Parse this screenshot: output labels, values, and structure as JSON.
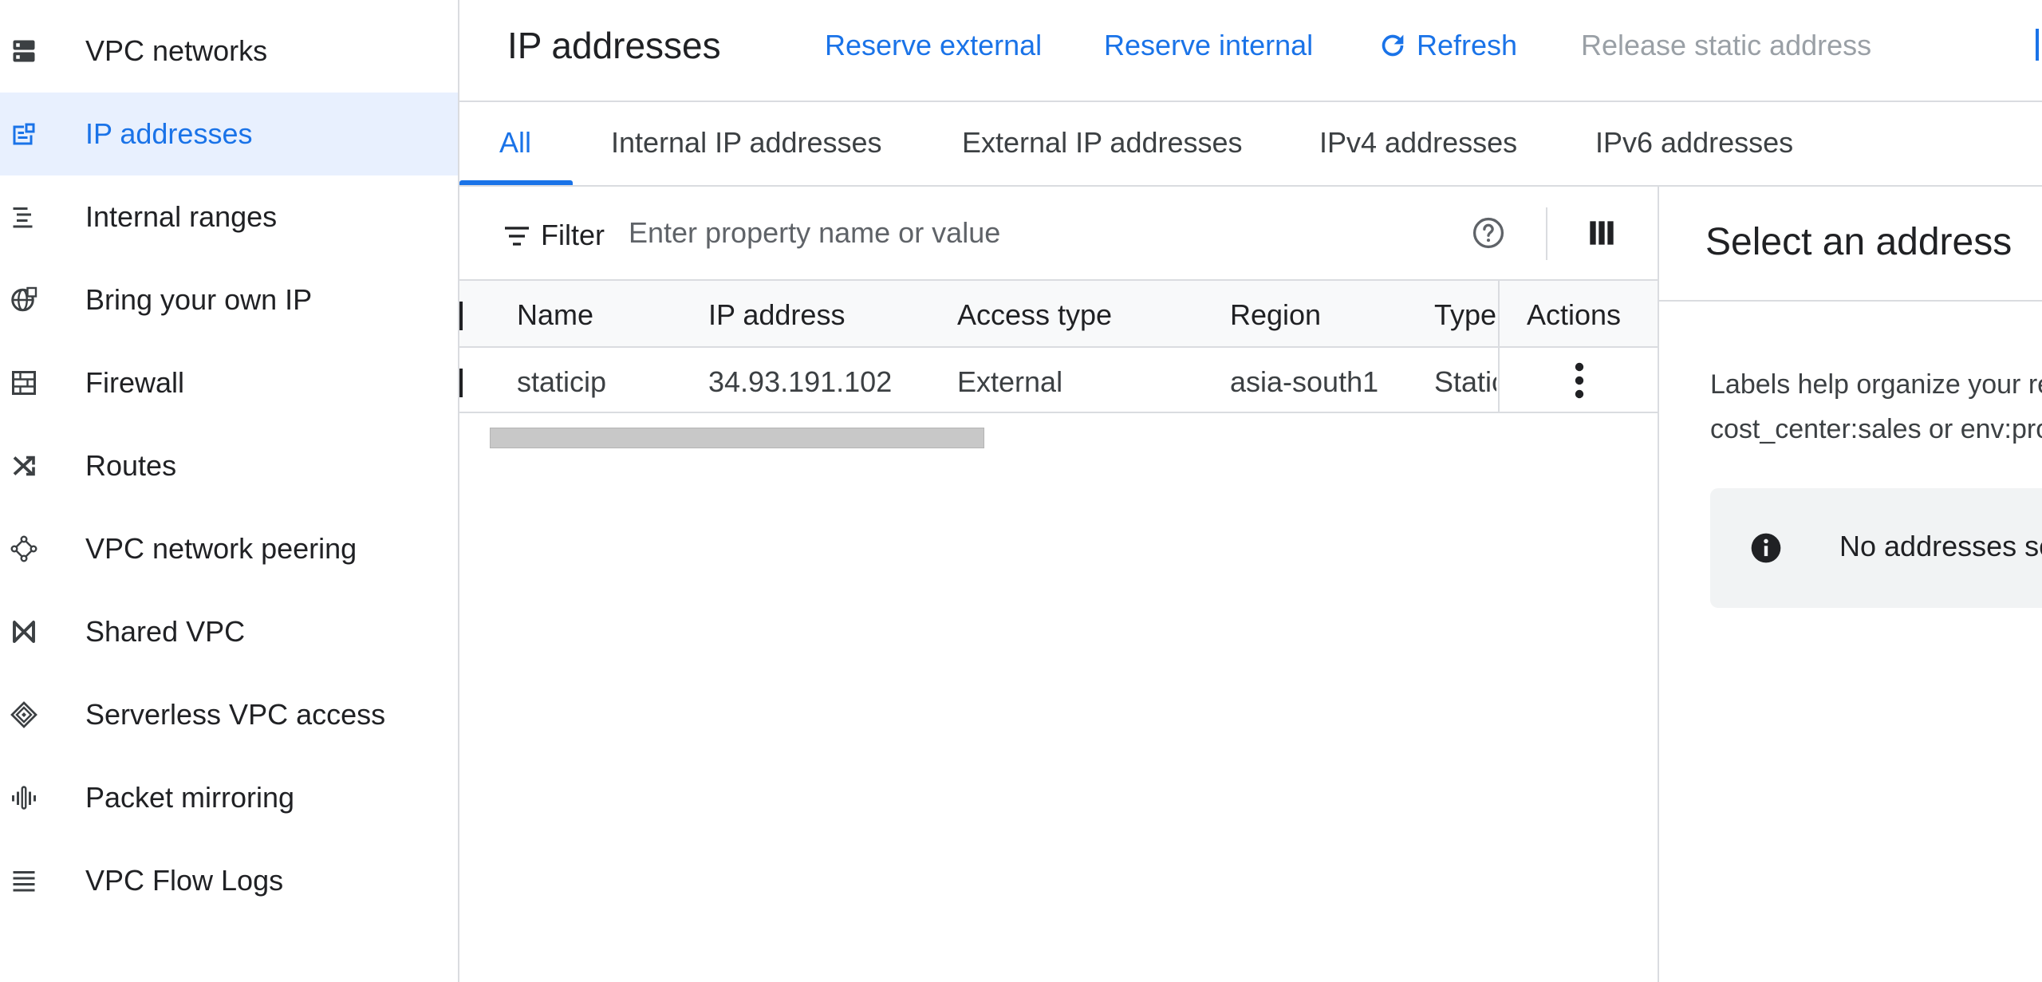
{
  "sidebar": {
    "items": [
      {
        "label": "VPC networks",
        "icon": "vpc-networks-icon"
      },
      {
        "label": "IP addresses",
        "icon": "ip-addresses-icon",
        "active": true
      },
      {
        "label": "Internal ranges",
        "icon": "internal-ranges-icon"
      },
      {
        "label": "Bring your own IP",
        "icon": "globe-icon"
      },
      {
        "label": "Firewall",
        "icon": "firewall-icon"
      },
      {
        "label": "Routes",
        "icon": "routes-icon"
      },
      {
        "label": "VPC network peering",
        "icon": "peering-icon"
      },
      {
        "label": "Shared VPC",
        "icon": "shared-vpc-icon"
      },
      {
        "label": "Serverless VPC access",
        "icon": "serverless-icon"
      },
      {
        "label": "Packet mirroring",
        "icon": "packet-mirroring-icon"
      },
      {
        "label": "VPC Flow Logs",
        "icon": "flow-logs-icon"
      }
    ]
  },
  "header": {
    "title": "IP addresses",
    "reserve_external": "Reserve external",
    "reserve_internal": "Reserve internal",
    "refresh": "Refresh",
    "release": "Release static address"
  },
  "tabs": [
    {
      "label": "All",
      "active": true
    },
    {
      "label": "Internal IP addresses"
    },
    {
      "label": "External IP addresses"
    },
    {
      "label": "IPv4 addresses"
    },
    {
      "label": "IPv6 addresses"
    }
  ],
  "filter": {
    "label": "Filter",
    "placeholder": "Enter property name or value"
  },
  "table": {
    "headers": {
      "name": "Name",
      "ip": "IP address",
      "access": "Access type",
      "region": "Region",
      "type": "Type",
      "actions": "Actions"
    },
    "rows": [
      {
        "name": "staticip",
        "ip": "34.93.191.102",
        "access": "External",
        "region": "asia-south1",
        "type": "Static"
      }
    ]
  },
  "panel": {
    "title": "Select an address",
    "help_line1": "Labels help organize your re",
    "help_line2": "cost_center:sales or env:pro",
    "notice": "No addresses se"
  },
  "colors": {
    "accent": "#1a73e8",
    "active_bg": "#e8f0fe",
    "disabled": "#9aa0a6",
    "border": "#dadce0"
  }
}
